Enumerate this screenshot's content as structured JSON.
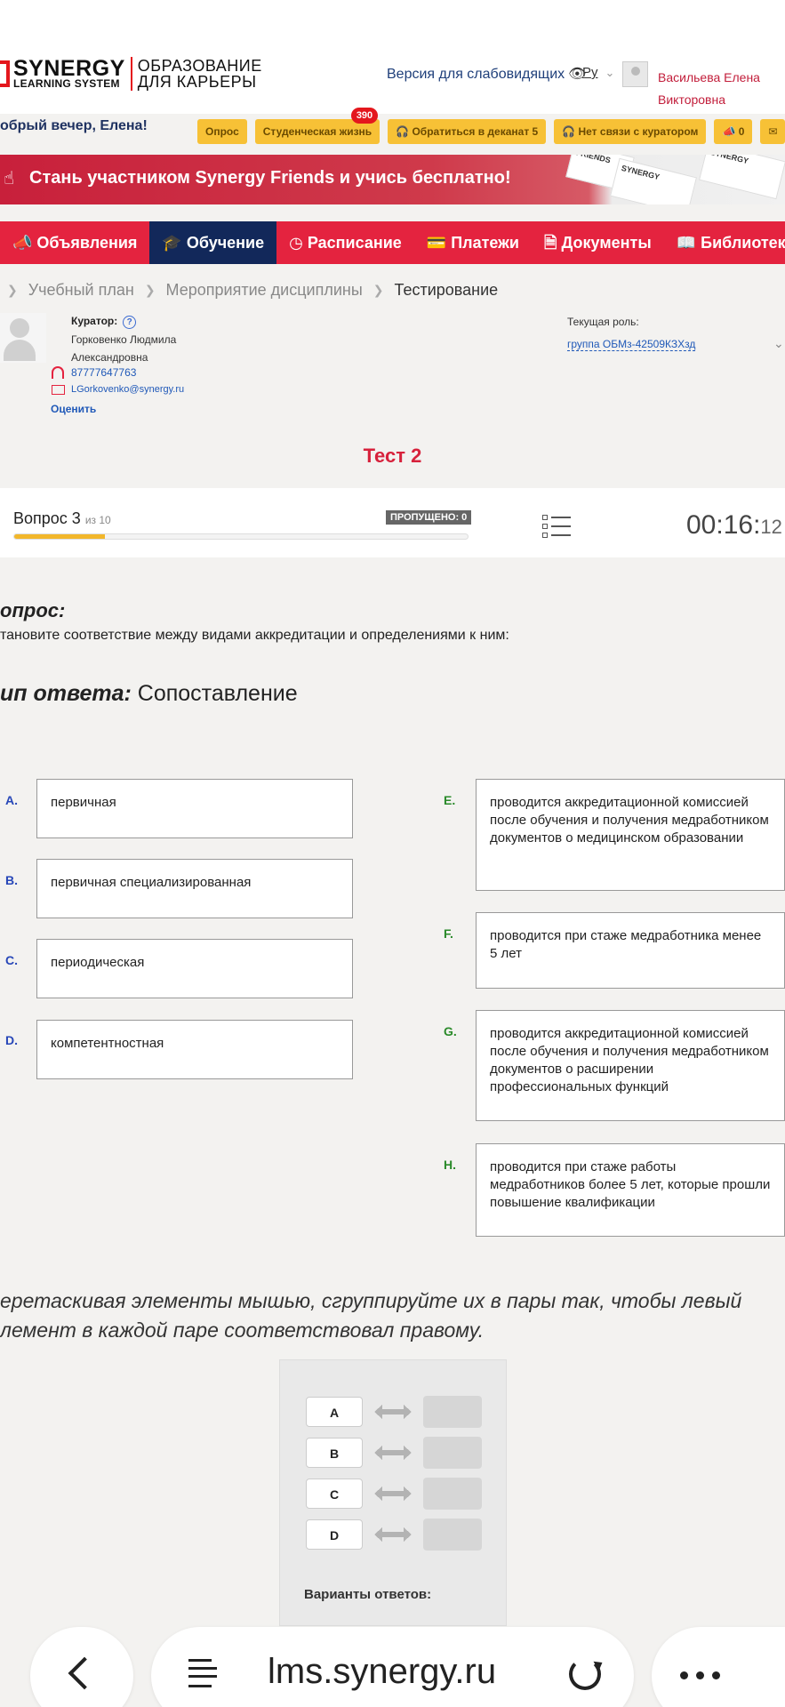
{
  "header": {
    "logo_synergy": "SYNERGY",
    "logo_learning": "LEARNING SYSTEM",
    "logo_edu_line1": "ОБРАЗОВАНИЕ",
    "logo_edu_line2": "ДЛЯ КАРЬЕРЫ",
    "vision_link": "Версия для слабовидящих",
    "language": "Ру",
    "user_name_line1": "Васильева Елена",
    "user_name_line2": "Викторовна"
  },
  "greeting": "обрый вечер, Елена!",
  "pills": [
    {
      "label": "Опрос"
    },
    {
      "label": "Студенческая жизнь",
      "badge": "390"
    },
    {
      "label": "Обратиться в деканат 5"
    },
    {
      "label": "Нет связи с куратором"
    },
    {
      "label": "0"
    }
  ],
  "banner": {
    "text": "Стань участником Synergy Friends и учись бесплатно!"
  },
  "nav": [
    {
      "label": "Объявления",
      "icon": "megaphone-icon"
    },
    {
      "label": "Обучение",
      "icon": "graduation-cap-icon",
      "active": true
    },
    {
      "label": "Расписание",
      "icon": "clock-icon"
    },
    {
      "label": "Платежи",
      "icon": "payment-icon"
    },
    {
      "label": "Документы",
      "icon": "document-icon"
    },
    {
      "label": "Библиотека",
      "icon": "book-icon"
    }
  ],
  "breadcrumbs": [
    "Учебный план",
    "Мероприятие дисциплины",
    "Тестирование"
  ],
  "curator": {
    "label": "Куратор:",
    "name_line1": "Горковенко Людмила",
    "name_line2": "Александровна",
    "phone": "87777647763",
    "email": "LGorkovenko@synergy.ru",
    "rate": "Оценить"
  },
  "role": {
    "label": "Текущая роль:",
    "value": "группа ОБМз-42509КЗХзд"
  },
  "test": {
    "title": "Тест 2"
  },
  "question_bar": {
    "question_label": "Вопрос 3",
    "of_label": "из 10",
    "skipped": "ПРОПУЩЕНО: 0",
    "progress": 0.2,
    "timer_main": "00:16:",
    "timer_sec": "12"
  },
  "question": {
    "heading": "опрос:",
    "text": "тановите соответствие между видами аккредитации и определениями к ним:",
    "answer_type_label": "ип ответа:",
    "answer_type_value": " Сопоставление"
  },
  "left_items": [
    {
      "letter": "A.",
      "text": "первичная"
    },
    {
      "letter": "B.",
      "text": "первичная специализированная"
    },
    {
      "letter": "C.",
      "text": "периодическая"
    },
    {
      "letter": "D.",
      "text": "компетентностная"
    }
  ],
  "right_items": [
    {
      "letter": "E.",
      "text": "проводится аккредитационной комиссией после обучения и получения медработником документов о медицинском образовании"
    },
    {
      "letter": "F.",
      "text": "проводится при стаже медработника менее 5 лет"
    },
    {
      "letter": "G.",
      "text": "проводится аккредитационной комиссией после обучения и получения медработником документов о расширении профессиональных функций"
    },
    {
      "letter": "H.",
      "text": "проводится при стаже работы медработников более 5 лет, которые прошли повышение квалификации"
    }
  ],
  "instruction_line1": "еретаскивая элементы мышью, сгруппируйте их в пары так, чтобы левый",
  "instruction_line2": "лемент в каждой паре соответствовал правому.",
  "dnd": {
    "pairs": [
      "A",
      "B",
      "C",
      "D"
    ],
    "variants_label": "Варианты ответов:"
  },
  "browser": {
    "host": "lms.synergy.ru"
  },
  "colors": {
    "brand_red": "#e4233f",
    "nav_active": "#12285a",
    "pill_yellow": "#f7c136"
  }
}
